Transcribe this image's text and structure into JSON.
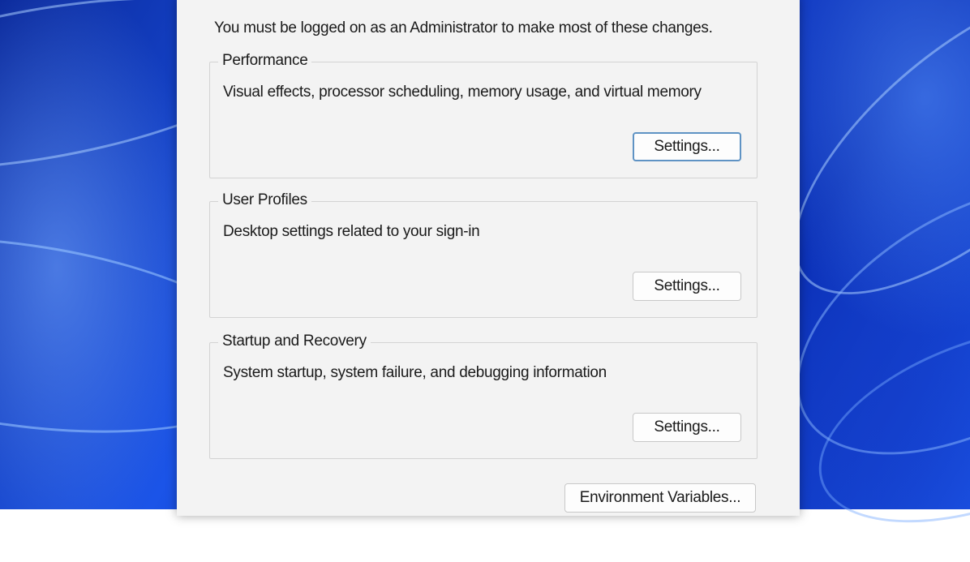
{
  "notice": "You must be logged on as an Administrator to make most of these changes.",
  "groups": [
    {
      "title": "Performance",
      "description": "Visual effects, processor scheduling, memory usage, and virtual memory",
      "button_label": "Settings..."
    },
    {
      "title": "User Profiles",
      "description": "Desktop settings related to your sign-in",
      "button_label": "Settings..."
    },
    {
      "title": "Startup and Recovery",
      "description": "System startup, system failure, and debugging information",
      "button_label": "Settings..."
    }
  ],
  "environment_button_label": "Environment Variables..."
}
